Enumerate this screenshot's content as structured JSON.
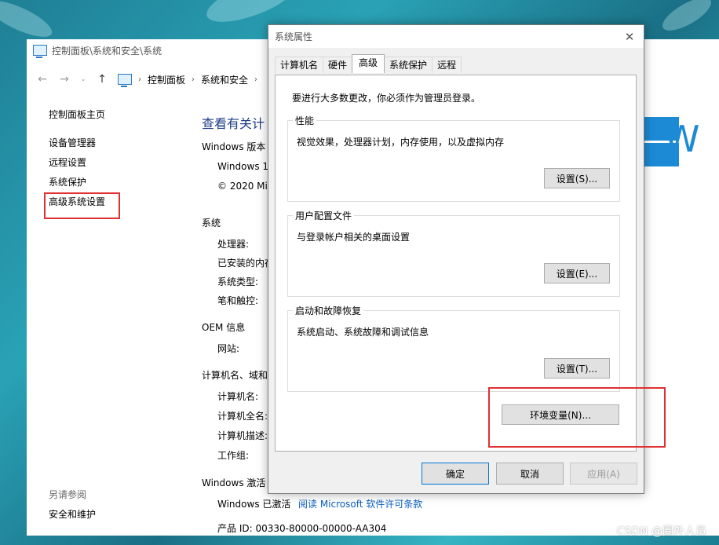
{
  "control_panel": {
    "title": "控制面板\\系统和安全\\系统",
    "breadcrumb": [
      "控制面板",
      "系统和安全"
    ],
    "sidebar": {
      "home": "控制面板主页",
      "links": [
        "设备管理器",
        "远程设置",
        "系统保护",
        "高级系统设置"
      ]
    },
    "see_also": {
      "title": "另请参阅",
      "links": [
        "安全和维护"
      ]
    },
    "main": {
      "title": "查看有关计",
      "windows_edition_header": "Windows 版本",
      "windows_name": "Windows 1",
      "copyright": "© 2020 Mi",
      "system_header": "系统",
      "processor": "处理器:",
      "installed_ram": "已安装的内存",
      "system_type": "系统类型:",
      "pen_touch": "笔和触控:",
      "oem_header": "OEM 信息",
      "website": "网站:",
      "computer_name_header": "计算机名、域和",
      "computer_name": "计算机名:",
      "full_name": "计算机全名:",
      "description": "计算机描述:",
      "workgroup": "工作组:",
      "activation_header": "Windows 激活",
      "activation_status": "Windows 已激活",
      "license_link": "阅读 Microsoft 软件许可条款",
      "product_id": "产品 ID: 00330-80000-00000-AA304"
    },
    "logo_letter": "W"
  },
  "dialog": {
    "title": "系统属性",
    "tabs": [
      "计算机名",
      "硬件",
      "高级",
      "系统保护",
      "远程"
    ],
    "admin_note": "要进行大多数更改，你必须作为管理员登录。",
    "performance": {
      "title": "性能",
      "desc": "视觉效果，处理器计划，内存使用，以及虚拟内存",
      "button": "设置(S)..."
    },
    "user_profiles": {
      "title": "用户配置文件",
      "desc": "与登录帐户相关的桌面设置",
      "button": "设置(E)..."
    },
    "startup_recovery": {
      "title": "启动和故障恢复",
      "desc": "系统启动、系统故障和调试信息",
      "button": "设置(T)..."
    },
    "env_button": "环境变量(N)...",
    "ok": "确定",
    "cancel": "取消",
    "apply": "应用(A)"
  },
  "watermark": "CSDN @圈外人员",
  "colors": {
    "highlight": "#e03131",
    "link": "#0a5fbf",
    "windows_blue": "#1d8ad6"
  }
}
